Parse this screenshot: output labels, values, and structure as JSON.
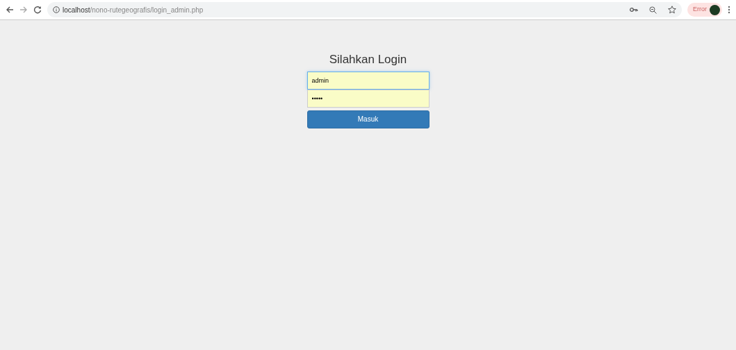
{
  "browser": {
    "url_host": "localhost",
    "url_path": "/nono-rutegeografis/login_admin.php",
    "error_label": "Error"
  },
  "login": {
    "title": "Silahkan Login",
    "username": {
      "value": "admin",
      "focused": true
    },
    "password": {
      "value": "•••••"
    },
    "submit": "Masuk"
  }
}
